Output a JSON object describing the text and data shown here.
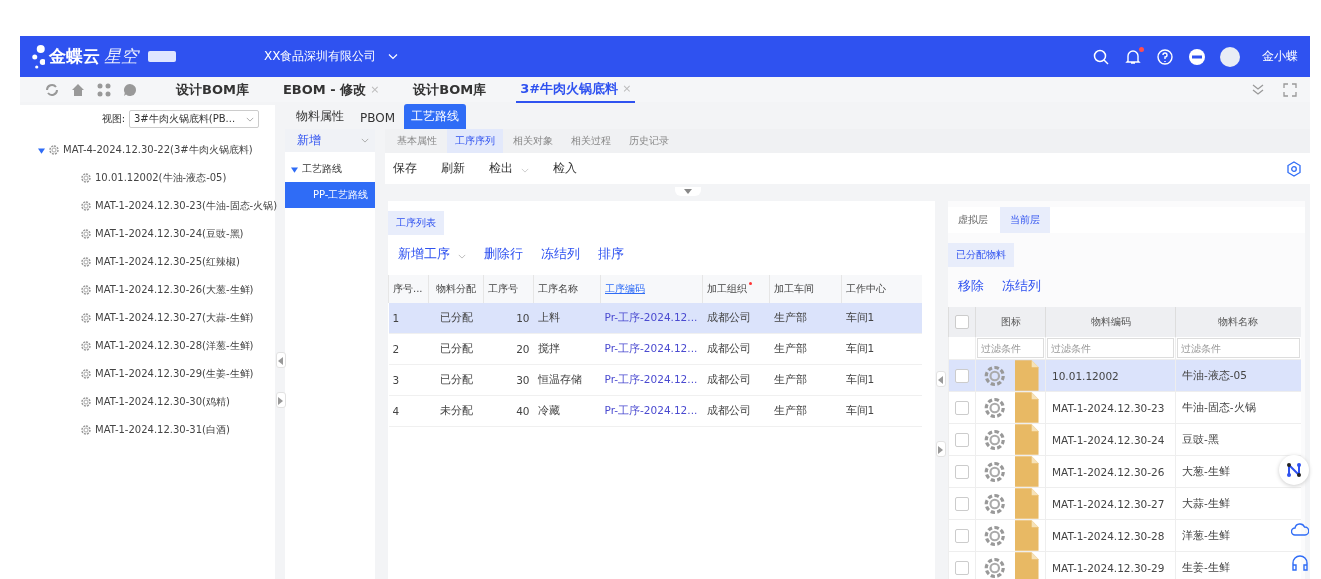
{
  "header": {
    "brand": "金蝶云",
    "brand_sub": "星空",
    "company": "XX食品深圳有限公司",
    "notification_dot": true,
    "user": "金小蝶"
  },
  "tabs": [
    {
      "label": "设计BOM库",
      "closable": false,
      "selected": false
    },
    {
      "label": "EBOM - 修改",
      "closable": true,
      "close": "×",
      "selected": false
    },
    {
      "label": "设计BOM库",
      "closable": false,
      "selected": false
    },
    {
      "label": "3#牛肉火锅底料",
      "closable": true,
      "close": "×",
      "selected": true
    }
  ],
  "left_panel": {
    "view_label": "视图:",
    "view_value": "3#牛肉火锅底料(PB...",
    "tree": [
      {
        "label": "MAT-4-2024.12.30-22(3#牛肉火锅底料)",
        "expanded": true,
        "children": [
          {
            "label": "10.01.12002(牛油-液态-05)"
          },
          {
            "label": "MAT-1-2024.12.30-23(牛油-固态-火锅)"
          },
          {
            "label": "MAT-1-2024.12.30-24(豆豉-黑)"
          },
          {
            "label": "MAT-1-2024.12.30-25(红辣椒)"
          },
          {
            "label": "MAT-1-2024.12.30-26(大葱-生鲜)"
          },
          {
            "label": "MAT-1-2024.12.30-27(大蒜-生鲜)"
          },
          {
            "label": "MAT-1-2024.12.30-28(洋葱-生鲜)"
          },
          {
            "label": "MAT-1-2024.12.30-29(生姜-生鲜)"
          },
          {
            "label": "MAT-1-2024.12.30-30(鸡精)"
          },
          {
            "label": "MAT-1-2024.12.30-31(白酒)"
          }
        ]
      }
    ]
  },
  "main_tabs": [
    {
      "label": "物料属性",
      "selected": false
    },
    {
      "label": "PBOM",
      "selected": false
    },
    {
      "label": "工艺路线",
      "selected": true
    }
  ],
  "route_panel": {
    "add_button": "新增",
    "tree": [
      {
        "label": "工艺路线",
        "expanded": true,
        "children": [
          {
            "label": "PP-工艺路线",
            "selected": true
          }
        ]
      }
    ]
  },
  "sub_tabs": [
    {
      "label": "基本属性",
      "selected": false
    },
    {
      "label": "工序序列",
      "selected": true
    },
    {
      "label": "相关对象",
      "selected": false
    },
    {
      "label": "相关过程",
      "selected": false
    },
    {
      "label": "历史记录",
      "selected": false
    }
  ],
  "toolbar": [
    {
      "label": "保存",
      "dropdown": false
    },
    {
      "label": "刷新",
      "dropdown": false
    },
    {
      "label": "检出",
      "dropdown": true
    },
    {
      "label": "检入",
      "dropdown": false
    }
  ],
  "operations": {
    "tab": "工序列表",
    "actions": [
      {
        "label": "新增工序",
        "dropdown": true
      },
      {
        "label": "删除行",
        "dropdown": false
      },
      {
        "label": "冻结列",
        "dropdown": false
      },
      {
        "label": "排序",
        "dropdown": false
      }
    ],
    "columns": [
      {
        "label": "序号...",
        "kind": "text",
        "required": false
      },
      {
        "label": "物料分配",
        "kind": "center",
        "required": false
      },
      {
        "label": "工序号",
        "kind": "number",
        "required": false
      },
      {
        "label": "工序名称",
        "kind": "text",
        "required": false
      },
      {
        "label": "工序编码",
        "kind": "link",
        "required": false
      },
      {
        "label": "加工组织",
        "kind": "text",
        "required": true
      },
      {
        "label": "加工车间",
        "kind": "text",
        "required": false
      },
      {
        "label": "工作中心",
        "kind": "text",
        "required": false
      }
    ],
    "rows": [
      {
        "selected": true,
        "cells": [
          "1",
          "已分配",
          "10",
          "上料",
          "Pr-工序-2024.12...",
          "成都公司",
          "生产部",
          "车间1"
        ]
      },
      {
        "selected": false,
        "cells": [
          "2",
          "已分配",
          "20",
          "搅拌",
          "Pr-工序-2024.12...",
          "成都公司",
          "生产部",
          "车间1"
        ]
      },
      {
        "selected": false,
        "cells": [
          "3",
          "已分配",
          "30",
          "恒温存储",
          "Pr-工序-2024.12...",
          "成都公司",
          "生产部",
          "车间1"
        ]
      },
      {
        "selected": false,
        "cells": [
          "4",
          "未分配",
          "40",
          "冷藏",
          "Pr-工序-2024.12...",
          "成都公司",
          "生产部",
          "车间1"
        ]
      }
    ]
  },
  "materials": {
    "tabs": [
      {
        "label": "虚拟层",
        "selected": false
      },
      {
        "label": "当前层",
        "selected": true
      }
    ],
    "section": "已分配物料",
    "actions": [
      "移除",
      "冻结列"
    ],
    "header_checked": false,
    "columns": [
      "图标",
      "物料编码",
      "物料名称"
    ],
    "filters": [
      {
        "placeholder": "过滤条件"
      },
      {
        "placeholder": "过滤条件"
      },
      {
        "placeholder": "过滤条件"
      }
    ],
    "rows": [
      {
        "code": "10.01.12002",
        "name": "牛油-液态-05",
        "selected": true,
        "checked": false
      },
      {
        "code": "MAT-1-2024.12.30-23",
        "name": "牛油-固态-火锅",
        "selected": false,
        "checked": false
      },
      {
        "code": "MAT-1-2024.12.30-24",
        "name": "豆豉-黑",
        "selected": false,
        "checked": false
      },
      {
        "code": "MAT-1-2024.12.30-26",
        "name": "大葱-生鲜",
        "selected": false,
        "checked": false
      },
      {
        "code": "MAT-1-2024.12.30-27",
        "name": "大蒜-生鲜",
        "selected": false,
        "checked": false
      },
      {
        "code": "MAT-1-2024.12.30-28",
        "name": "洋葱-生鲜",
        "selected": false,
        "checked": false
      },
      {
        "code": "MAT-1-2024.12.30-29",
        "name": "生姜-生鲜",
        "selected": false,
        "checked": false
      }
    ]
  }
}
